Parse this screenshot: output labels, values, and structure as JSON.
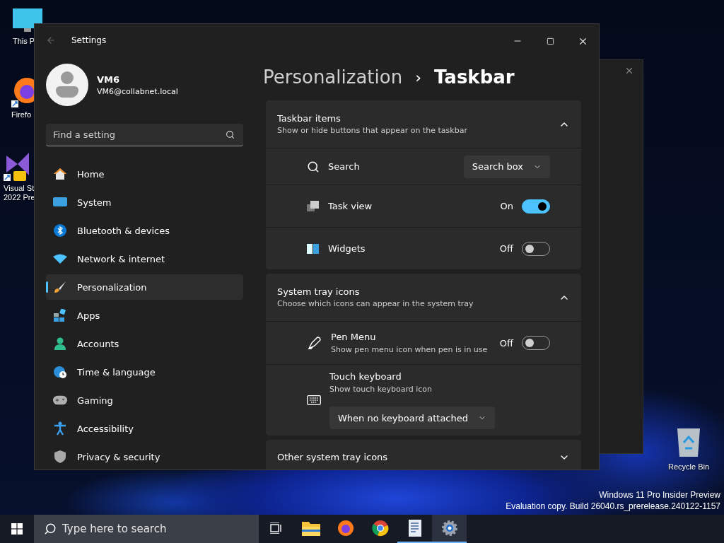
{
  "desktop_icons": [
    {
      "label": "This P"
    },
    {
      "label": "Firefo"
    },
    {
      "label": "Visual St",
      "label_line_2": "2022 Pre"
    }
  ],
  "recycle_bin": {
    "label": "Recycle Bin"
  },
  "watermark_os": {
    "line_1": "Windows 11 Pro Insider Preview",
    "line_2": "Evaluation copy. Build 26040.rs_prerelease.240122-1157"
  },
  "settings_window": {
    "title": "Settings",
    "profile": {
      "name": "VM6",
      "email": "VM6@collabnet.local"
    },
    "search": {
      "placeholder": "Find a setting"
    },
    "nav": [
      {
        "label": "Home",
        "selected": false
      },
      {
        "label": "System",
        "selected": false
      },
      {
        "label": "Bluetooth & devices",
        "selected": false
      },
      {
        "label": "Network & internet",
        "selected": false
      },
      {
        "label": "Personalization",
        "selected": true
      },
      {
        "label": "Apps",
        "selected": false
      },
      {
        "label": "Accounts",
        "selected": false
      },
      {
        "label": "Time & language",
        "selected": false
      },
      {
        "label": "Gaming",
        "selected": false
      },
      {
        "label": "Accessibility",
        "selected": false
      },
      {
        "label": "Privacy & security",
        "selected": false
      }
    ],
    "breadcrumb": {
      "parent": "Personalization",
      "separator": "›",
      "current": "Taskbar"
    },
    "sections": [
      {
        "title": "Taskbar items",
        "subtitle": "Show or hide buttons that appear on the taskbar",
        "expanded": true,
        "rows": [
          {
            "kind": "dropdown",
            "label": "Search",
            "value": "Search box"
          },
          {
            "kind": "toggle",
            "label": "Task view",
            "on": true,
            "state_text": "On"
          },
          {
            "kind": "toggle",
            "label": "Widgets",
            "on": false,
            "state_text": "Off"
          }
        ]
      },
      {
        "title": "System tray icons",
        "subtitle": "Choose which icons can appear in the system tray",
        "expanded": true,
        "rows": [
          {
            "kind": "toggle",
            "label": "Pen Menu",
            "description": "Show pen menu icon when pen is in use",
            "on": false,
            "state_text": "Off"
          },
          {
            "kind": "dropdown_below",
            "label": "Touch keyboard",
            "description": "Show touch keyboard icon",
            "value": "When no keyboard attached"
          }
        ]
      },
      {
        "title": "Other system tray icons",
        "expanded": false
      }
    ]
  },
  "taskbar": {
    "search_placeholder": "Type here to search",
    "apps": [
      {
        "running": false
      },
      {
        "running": false
      },
      {
        "running": false
      },
      {
        "running": false
      },
      {
        "running": true
      },
      {
        "running": true
      }
    ]
  }
}
